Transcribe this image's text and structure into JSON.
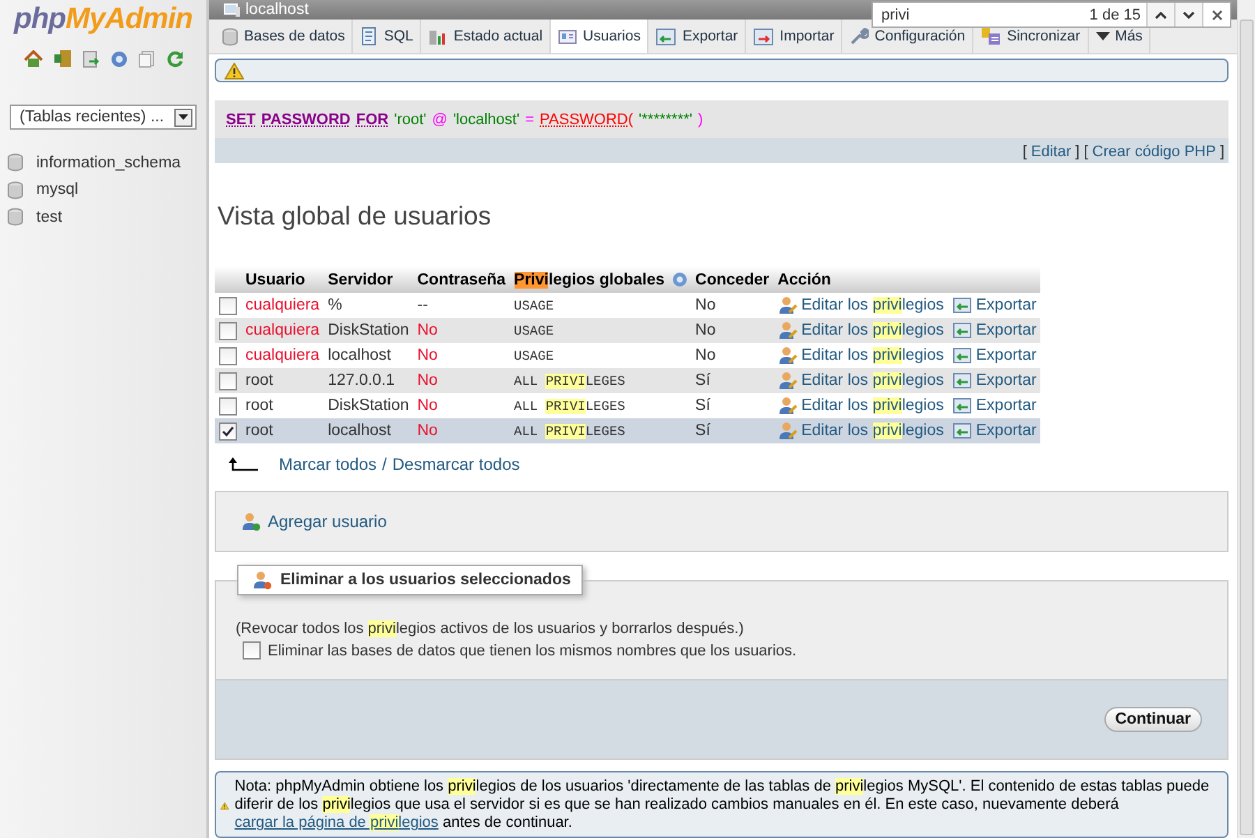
{
  "server_bar": {
    "title": "localhost"
  },
  "tabs": [
    {
      "label": "Bases de datos",
      "selected": false
    },
    {
      "label": "SQL",
      "selected": false
    },
    {
      "label": "Estado actual",
      "selected": false
    },
    {
      "label": "Usuarios",
      "selected": true
    },
    {
      "label": "Exportar",
      "selected": false
    },
    {
      "label": "Importar",
      "selected": false
    },
    {
      "label": "Configuración",
      "selected": false
    },
    {
      "label": "Sincronizar",
      "selected": false
    },
    {
      "label": "Más",
      "selected": false
    }
  ],
  "find_bar": {
    "value": "privi",
    "count": "1 de 15"
  },
  "sidebar": {
    "logo_php": "php",
    "logo_name": "MyAdmin",
    "recent_tables": "(Tablas recientes) ...",
    "databases": [
      "information_schema",
      "mysql",
      "test"
    ]
  },
  "sql_box": {
    "tokens": [
      {
        "text": "SET",
        "kind": "keyword"
      },
      {
        "text": "PASSWORD",
        "kind": "keyword"
      },
      {
        "text": "FOR",
        "kind": "keyword"
      },
      {
        "text": "'root'",
        "kind": "string"
      },
      {
        "text": "@",
        "kind": "operator"
      },
      {
        "text": "'localhost'",
        "kind": "string"
      },
      {
        "text": "=",
        "kind": "operator"
      },
      {
        "text": "PASSWORD(",
        "kind": "function"
      },
      {
        "text": "'********'",
        "kind": "string"
      },
      {
        "text": ")",
        "kind": "operator"
      }
    ],
    "links": [
      {
        "text": "[",
        "kind": "bracket"
      },
      {
        "text": "Editar",
        "kind": "link"
      },
      {
        "text": "]",
        "kind": "bracket"
      },
      {
        "text": "[",
        "kind": "bracket"
      },
      {
        "text": "Crear código PHP",
        "kind": "link"
      },
      {
        "text": "]",
        "kind": "bracket"
      }
    ]
  },
  "heading": "Vista global de usuarios",
  "table": {
    "columns": [
      {
        "parts": [
          {
            "text": "Usuario",
            "highlight": false
          }
        ],
        "help": false
      },
      {
        "parts": [
          {
            "text": "Servidor",
            "highlight": false
          }
        ],
        "help": false
      },
      {
        "parts": [
          {
            "text": "Contraseña",
            "highlight": false
          }
        ],
        "help": false
      },
      {
        "parts": [
          {
            "text": "Privi",
            "highlight": true,
            "current": true
          },
          {
            "text": "legios globales",
            "highlight": false,
            "current": false
          }
        ],
        "help": true
      },
      {
        "parts": [
          {
            "text": "Conceder",
            "highlight": false
          }
        ],
        "help": false
      },
      {
        "parts": [
          {
            "text": "Acción",
            "highlight": false
          }
        ],
        "help": false
      }
    ],
    "rows": [
      {
        "checked": false,
        "user": {
          "text": "cualquiera",
          "color": "#e8102c"
        },
        "server": "%",
        "password": {
          "text": "--",
          "color": "#333333"
        },
        "privileges": [
          {
            "text": "USAGE",
            "highlight": false
          }
        ],
        "grant": "No",
        "edit": [
          {
            "text": "Editar los ",
            "highlight": false
          },
          {
            "text": "privi",
            "highlight": true
          },
          {
            "text": "legios",
            "highlight": false
          }
        ],
        "export": "Exportar"
      },
      {
        "checked": false,
        "user": {
          "text": "cualquiera",
          "color": "#e8102c"
        },
        "server": "DiskStation",
        "password": {
          "text": "No",
          "color": "#e8102c"
        },
        "privileges": [
          {
            "text": "USAGE",
            "highlight": false
          }
        ],
        "grant": "No",
        "edit": [
          {
            "text": "Editar los ",
            "highlight": false
          },
          {
            "text": "privi",
            "highlight": true
          },
          {
            "text": "legios",
            "highlight": false
          }
        ],
        "export": "Exportar"
      },
      {
        "checked": false,
        "user": {
          "text": "cualquiera",
          "color": "#e8102c"
        },
        "server": "localhost",
        "password": {
          "text": "No",
          "color": "#e8102c"
        },
        "privileges": [
          {
            "text": "USAGE",
            "highlight": false
          }
        ],
        "grant": "No",
        "edit": [
          {
            "text": "Editar los ",
            "highlight": false
          },
          {
            "text": "privi",
            "highlight": true
          },
          {
            "text": "legios",
            "highlight": false
          }
        ],
        "export": "Exportar"
      },
      {
        "checked": false,
        "user": {
          "text": "root",
          "color": "#333333"
        },
        "server": "127.0.0.1",
        "password": {
          "text": "No",
          "color": "#e8102c"
        },
        "privileges": [
          {
            "text": "ALL ",
            "highlight": false
          },
          {
            "text": "PRIVI",
            "highlight": true
          },
          {
            "text": "LEGES",
            "highlight": false
          }
        ],
        "grant": "Sí",
        "edit": [
          {
            "text": "Editar los ",
            "highlight": false
          },
          {
            "text": "privi",
            "highlight": true
          },
          {
            "text": "legios",
            "highlight": false
          }
        ],
        "export": "Exportar"
      },
      {
        "checked": false,
        "user": {
          "text": "root",
          "color": "#333333"
        },
        "server": "DiskStation",
        "password": {
          "text": "No",
          "color": "#e8102c"
        },
        "privileges": [
          {
            "text": "ALL ",
            "highlight": false
          },
          {
            "text": "PRIVI",
            "highlight": true
          },
          {
            "text": "LEGES",
            "highlight": false
          }
        ],
        "grant": "Sí",
        "edit": [
          {
            "text": "Editar los ",
            "highlight": false
          },
          {
            "text": "privi",
            "highlight": true
          },
          {
            "text": "legios",
            "highlight": false
          }
        ],
        "export": "Exportar"
      },
      {
        "checked": true,
        "user": {
          "text": "root",
          "color": "#333333"
        },
        "server": "localhost",
        "password": {
          "text": "No",
          "color": "#e8102c"
        },
        "privileges": [
          {
            "text": "ALL ",
            "highlight": false
          },
          {
            "text": "PRIVI",
            "highlight": true
          },
          {
            "text": "LEGES",
            "highlight": false
          }
        ],
        "grant": "Sí",
        "edit": [
          {
            "text": "Editar los ",
            "highlight": false
          },
          {
            "text": "privi",
            "highlight": true
          },
          {
            "text": "legios",
            "highlight": false
          }
        ],
        "export": "Exportar"
      }
    ]
  },
  "select_all": {
    "mark_all": "Marcar todos",
    "separator": "/",
    "unmark_all": "Desmarcar todos"
  },
  "add_user": "Agregar usuario",
  "delete_section": {
    "legend": "Eliminar a los usuarios seleccionados",
    "description": [
      {
        "text": "(Revocar todos los ",
        "highlight": false
      },
      {
        "text": "privi",
        "highlight": true
      },
      {
        "text": "legios activos de los usuarios y borrarlos después.)",
        "highlight": false
      }
    ],
    "drop_databases": {
      "label": "Eliminar las bases de datos que tienen los mismos nombres que los usuarios.",
      "checked": false
    },
    "submit": "Continuar"
  },
  "note": {
    "before": [
      {
        "text": "Nota: phpMyAdmin obtiene los ",
        "highlight": false
      },
      {
        "text": "privi",
        "highlight": true
      },
      {
        "text": "legios de los usuarios 'directamente de las tablas de ",
        "highlight": false
      },
      {
        "text": "privi",
        "highlight": true
      },
      {
        "text": "legios MySQL'. El contenido de estas tablas puede diferir de los ",
        "highlight": false
      },
      {
        "text": "privi",
        "highlight": true
      },
      {
        "text": "legios que usa el servidor si es que se han realizado cambios manuales en él. En este caso, nuevamente deberá ",
        "highlight": false
      }
    ],
    "link": [
      {
        "text": "cargar la página de ",
        "highlight": false
      },
      {
        "text": "privi",
        "highlight": true
      },
      {
        "text": "legios",
        "highlight": false
      }
    ],
    "after": [
      {
        "text": " antes de continuar.",
        "highlight": false
      }
    ]
  }
}
